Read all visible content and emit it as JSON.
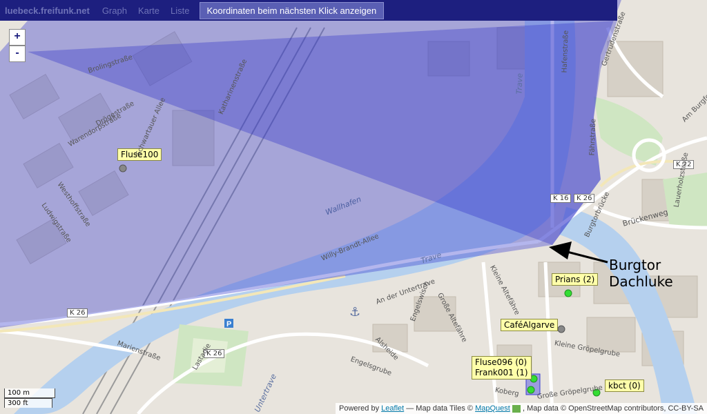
{
  "topbar": {
    "brand": "luebeck.freifunk.net",
    "nav": [
      "Graph",
      "Karte",
      "Liste"
    ],
    "action": "Koordinaten beim nächsten Klick anzeigen"
  },
  "zoom": {
    "in": "+",
    "out": "-"
  },
  "nodes": [
    {
      "label": "Fluse100",
      "status": "offline"
    },
    {
      "label": "Prians (2)",
      "status": "online"
    },
    {
      "label": "CaféAlgarve",
      "status": "offline"
    },
    {
      "label": "Fluse096 (0)",
      "status": "online"
    },
    {
      "label": "Frank001 (1)",
      "status": "online"
    },
    {
      "label": "kbct (0)",
      "status": "online"
    }
  ],
  "annotation": {
    "line1": "Burgtor",
    "line2": "Dachluke"
  },
  "roads": {
    "shields": [
      "K 26",
      "K 16",
      "K 26",
      "K 22",
      "K 26"
    ],
    "streets": [
      "Brolingstraße",
      "Schwartauer Allee",
      "Katharinenstraße",
      "Warendorpstraße",
      "Drögestraße",
      "Westhoffstraße",
      "Ludwigstraße",
      "Wallhafen",
      "Willy-Brandt-Allee",
      "An der Untertrave",
      "Große Altefähre",
      "Kleine Altefähre",
      "Engelswisch",
      "Alsheide",
      "Engelsgrube",
      "Marienstraße",
      "Lastadie",
      "Kleine Gröpelgrube",
      "Große Gröpelgrube",
      "Hafenstraße",
      "Fährstraße",
      "Burgtorbrücke",
      "Brückenweg",
      "Am Burgfeld",
      "Gertrudenstraße",
      "Lauerholzstraße",
      "Koberg"
    ],
    "water": [
      "Trave",
      "Trave",
      "Untertrave"
    ]
  },
  "scale": {
    "metric": "100 m",
    "imperial": "300 ft"
  },
  "attribution": {
    "powered": "Powered by",
    "leaflet": "Leaflet",
    "mid": "— Map data Tiles ©",
    "mapquest": "MapQuest",
    "rest": ", Map data © OpenStreetMap contributors, CC-BY-SA"
  },
  "colors": {
    "topbar": "#1d1f7f",
    "coverage": "#5558d0",
    "online": "#33dd33",
    "offline": "#888888",
    "water": "#b5d0ee",
    "land": "#e8e4dd"
  }
}
